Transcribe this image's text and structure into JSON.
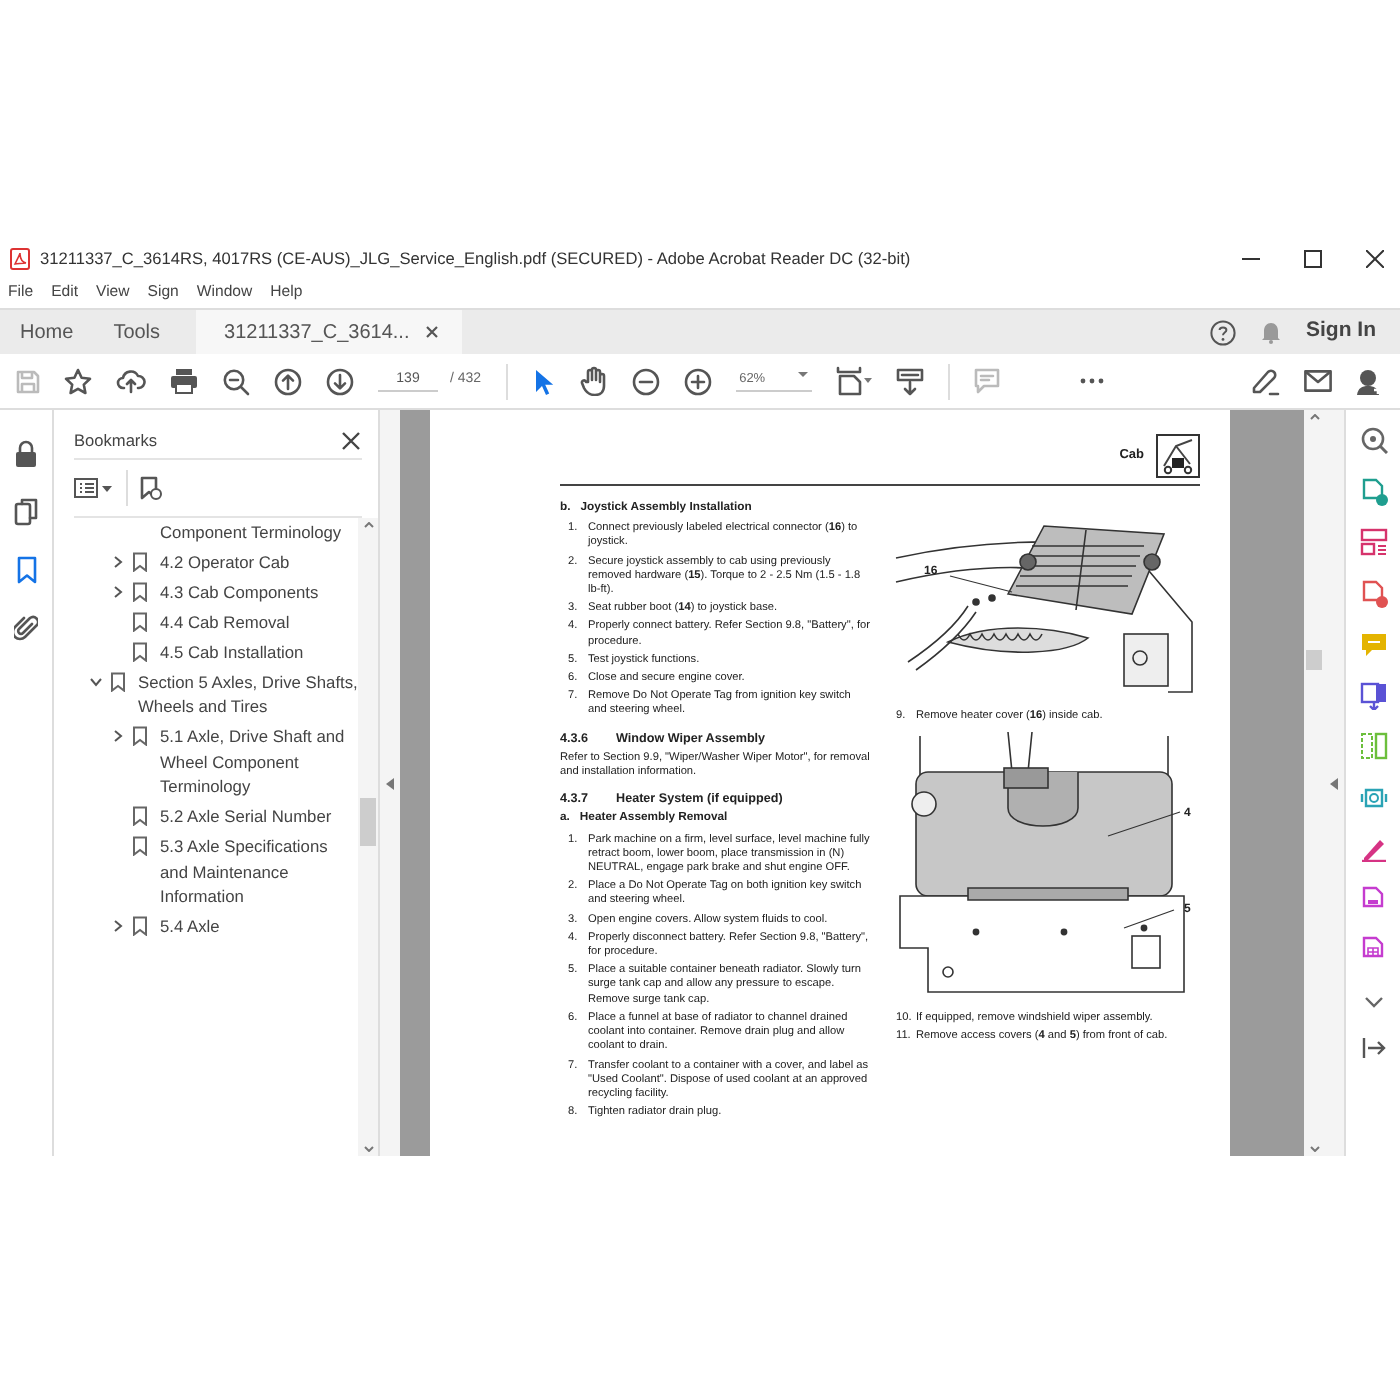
{
  "window": {
    "title": "31211337_C_3614RS, 4017RS (CE-AUS)_JLG_Service_English.pdf (SECURED) - Adobe Acrobat Reader DC (32-bit)"
  },
  "menu": [
    "File",
    "Edit",
    "View",
    "Sign",
    "Window",
    "Help"
  ],
  "tabs": [
    {
      "label": "Home",
      "selected": false
    },
    {
      "label": "Tools",
      "selected": false
    },
    {
      "label": "31211337_C_3614...",
      "selected": true
    }
  ],
  "sign_in": "Sign In",
  "toolbar": {
    "page_number": "139",
    "page_total": "/ 432",
    "zoom": "62%",
    "pointer_tools": [
      {
        "kind": "select",
        "selected": true
      },
      {
        "kind": "hand",
        "selected": false
      }
    ]
  },
  "side_rail": [
    {
      "kind": "lock",
      "selected": false
    },
    {
      "kind": "pages",
      "selected": false
    },
    {
      "kind": "bookmarks",
      "selected": true
    },
    {
      "kind": "attachments",
      "selected": false
    }
  ],
  "bookmarks": {
    "title": "Bookmarks",
    "items": [
      {
        "children": [
          {
            "label": "Component Terminology",
            "kind": "continuation"
          },
          {
            "label": "4.2 Operator Cab",
            "expanded": false
          },
          {
            "label": "4.3 Cab Components",
            "expanded": false
          },
          {
            "label": "4.4 Cab Removal"
          },
          {
            "label": "4.5 Cab Installation"
          }
        ]
      },
      {
        "label": "Section 5 Axles, Drive Shafts, Wheels and Tires",
        "expanded": true,
        "children": [
          {
            "label": "5.1 Axle, Drive Shaft and Wheel Component Terminology",
            "expanded": false
          },
          {
            "label": "5.2 Axle Serial Number"
          },
          {
            "label": "5.3 Axle Specifications and Maintenance Information"
          },
          {
            "label": "5.4 Axle",
            "expanded": false
          }
        ]
      }
    ]
  },
  "document": {
    "header": "Cab",
    "left_column": [
      {
        "kind": "subheading",
        "marker": "b.",
        "text": "Joystick Assembly Installation"
      },
      {
        "kind": "steps",
        "items": [
          {
            "number": "1.",
            "text": "Connect previously labeled electrical connector (**16**) to joystick."
          },
          {
            "number": "2.",
            "text": "Secure joystick assembly to cab using previously removed hardware (**15**). Torque to 2 - 2.5 Nm (1.5 - 1.8 lb-ft)."
          },
          {
            "number": "3.",
            "text": "Seat rubber boot (**14**) to joystick base."
          },
          {
            "number": "4.",
            "text": "Properly connect battery. Refer Section 9.8, \"Battery\", for procedure."
          },
          {
            "number": "5.",
            "text": "Test joystick functions."
          },
          {
            "number": "6.",
            "text": "Close and secure engine cover."
          },
          {
            "number": "7.",
            "text": "Remove Do Not Operate Tag from ignition key switch and steering wheel."
          }
        ]
      },
      {
        "kind": "section",
        "number": "4.3.6",
        "text": "Window Wiper Assembly"
      },
      {
        "kind": "paragraph",
        "text": "Refer to Section 9.9, \"Wiper/Washer Wiper Motor\", for removal and installation information."
      },
      {
        "kind": "section",
        "number": "4.3.7",
        "text": "Heater System (if equipped)"
      },
      {
        "kind": "subheading",
        "marker": "a.",
        "text": "Heater Assembly Removal"
      },
      {
        "kind": "steps",
        "items": [
          {
            "number": "1.",
            "text": "Park machine on a firm, level surface, level machine fully retract boom, lower boom, place transmission in (N) NEUTRAL, engage park brake and shut engine OFF."
          },
          {
            "number": "2.",
            "text": "Place a Do Not Operate Tag on both ignition key switch and steering wheel."
          },
          {
            "number": "3.",
            "text": "Open engine covers. Allow system fluids to cool."
          },
          {
            "number": "4.",
            "text": "Properly disconnect battery. Refer Section 9.8, \"Battery\", for procedure."
          },
          {
            "number": "5.",
            "text": "Place a suitable container beneath radiator. Slowly turn surge tank cap and allow any pressure to escape. Remove surge tank cap."
          },
          {
            "number": "6.",
            "text": "Place a funnel at base of radiator to channel drained coolant into container. Remove drain plug and allow coolant to drain."
          },
          {
            "number": "7.",
            "text": "Transfer coolant to a container with a cover, and label as \"Used Coolant\". Dispose of used coolant at an approved recycling facility."
          },
          {
            "number": "8.",
            "text": "Tighten radiator drain plug."
          }
        ]
      }
    ],
    "right_column": [
      {
        "kind": "heater_figure",
        "callouts": [
          "16"
        ]
      },
      {
        "kind": "steps",
        "items": [
          {
            "number": "9.",
            "text": "Remove heater cover (**16**) inside cab."
          }
        ]
      },
      {
        "kind": "covers_figure",
        "callouts": [
          "4",
          "5"
        ]
      },
      {
        "kind": "steps",
        "items": [
          {
            "number": "10.",
            "text": "If equipped, remove windshield wiper assembly."
          },
          {
            "number": "11.",
            "text": "Remove access covers (**4** and **5**) from front of cab."
          }
        ]
      }
    ]
  }
}
